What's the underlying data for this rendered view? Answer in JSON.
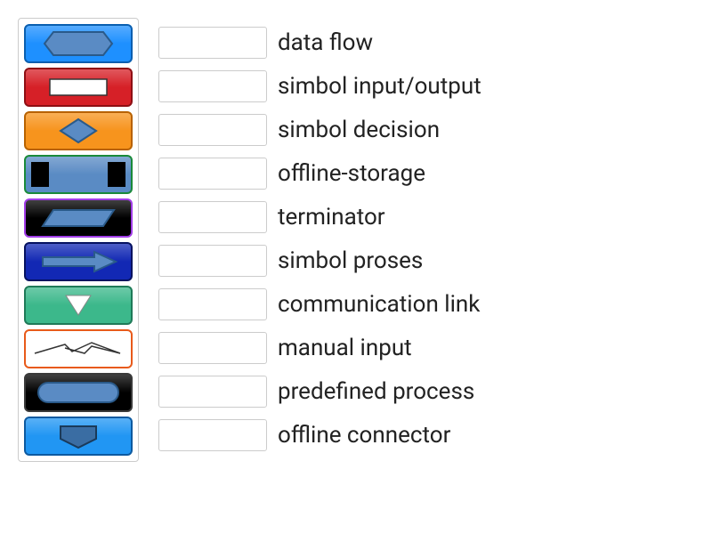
{
  "tiles": [
    {
      "id": "hexagon",
      "bg": "#1e90ff",
      "border": "#0a5fb0"
    },
    {
      "id": "rectangle",
      "bg": "#d62027",
      "border": "#8e0f14"
    },
    {
      "id": "diamond",
      "bg": "#f7941d",
      "border": "#b86200"
    },
    {
      "id": "vbar-rect",
      "bg": "#5a8bc4",
      "border": "#1a8a3a"
    },
    {
      "id": "parallelogram",
      "bg": "#000000",
      "border": "#a23de8"
    },
    {
      "id": "arrow",
      "bg": "#1228b4",
      "border": "#061260"
    },
    {
      "id": "triangle",
      "bg": "#3cb88b",
      "border": "#1f7a58"
    },
    {
      "id": "lightning",
      "bg": "#ffffff",
      "border": "#e85a1a"
    },
    {
      "id": "stadium",
      "bg": "#000000",
      "border": "#3a3a3a"
    },
    {
      "id": "pentagon-down",
      "bg": "#2196f3",
      "border": "#0d5aa0"
    }
  ],
  "answers": [
    {
      "label": "data flow"
    },
    {
      "label": "simbol input/output"
    },
    {
      "label": "simbol decision"
    },
    {
      "label": "offline-storage"
    },
    {
      "label": "terminator"
    },
    {
      "label": "simbol proses"
    },
    {
      "label": "communication link"
    },
    {
      "label": "manual input"
    },
    {
      "label": "predefined process"
    },
    {
      "label": "offline connector"
    }
  ],
  "shapeFill": "#5a8bc4",
  "shapeStroke": "#2a5a8a"
}
